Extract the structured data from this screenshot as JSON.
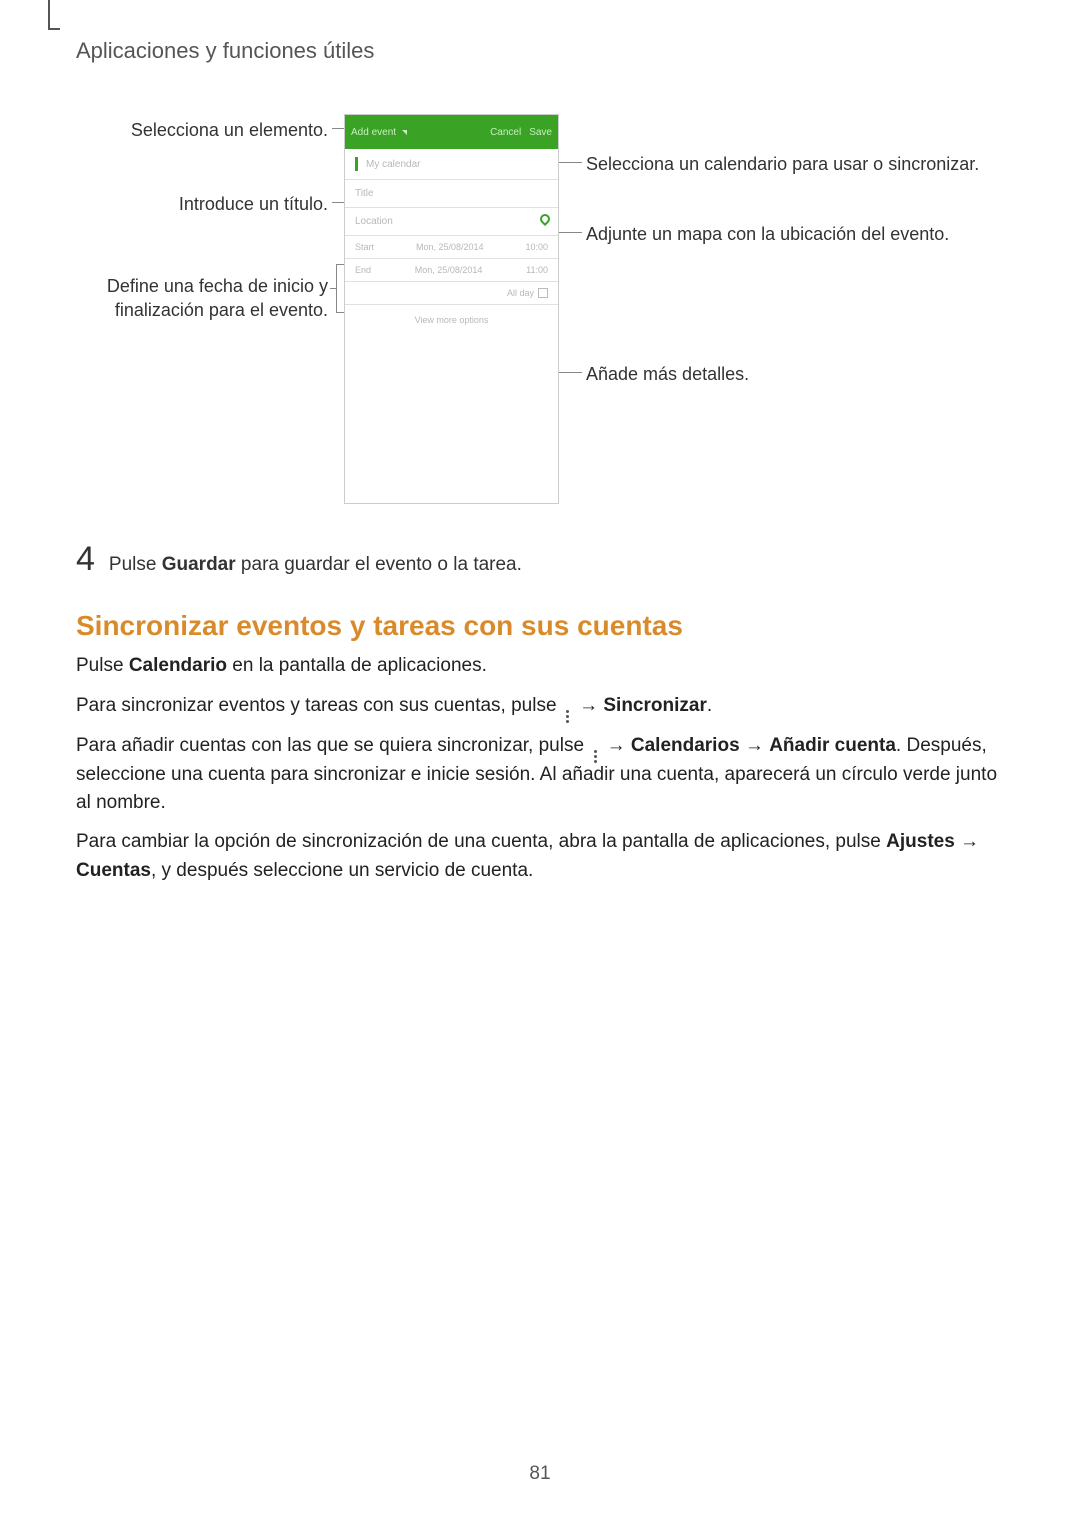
{
  "header": "Aplicaciones y funciones útiles",
  "page_number": "81",
  "callouts": {
    "select_item": "Selecciona un elemento.",
    "enter_title": "Introduce un título.",
    "define_dates": "Define una fecha de inicio y finalización para el evento.",
    "select_calendar": "Selecciona un calendario para usar o sincronizar.",
    "attach_map": "Adjunte un mapa con la ubicación del evento.",
    "add_details": "Añade más detalles."
  },
  "phone": {
    "add_event": "Add event",
    "cancel": "Cancel",
    "save": "Save",
    "my_calendar": "My calendar",
    "title": "Title",
    "location": "Location",
    "start": "Start",
    "end": "End",
    "start_date": "Mon, 25/08/2014",
    "start_time": "10:00",
    "end_date": "Mon, 25/08/2014",
    "end_time": "11:00",
    "all_day": "All day",
    "view_more": "View more options"
  },
  "step4": {
    "num": "4",
    "pre": "Pulse ",
    "bold": "Guardar",
    "post": " para guardar el evento o la tarea."
  },
  "h2": "Sincronizar eventos y tareas con sus cuentas",
  "p1": {
    "pre": "Pulse ",
    "bold": "Calendario",
    "post": " en la pantalla de aplicaciones."
  },
  "p2": {
    "pre": "Para sincronizar eventos y tareas con sus cuentas, pulse ",
    "arrow": " → ",
    "bold": "Sincronizar",
    "end": "."
  },
  "p3": {
    "pre": "Para añadir cuentas con las que se quiera sincronizar, pulse ",
    "arrow1": " → ",
    "bold1": "Calendarios",
    "arrow2": " → ",
    "bold2": "Añadir cuenta",
    "period": ". ",
    "rest": "Después, seleccione una cuenta para sincronizar e inicie sesión. Al añadir una cuenta, aparecerá un círculo verde junto al nombre."
  },
  "p4": {
    "pre": "Para cambiar la opción de sincronización de una cuenta, abra la pantalla de aplicaciones, pulse ",
    "bold1": "Ajustes",
    "arrow": " → ",
    "bold2": "Cuentas",
    "post": ", y después seleccione un servicio de cuenta."
  }
}
